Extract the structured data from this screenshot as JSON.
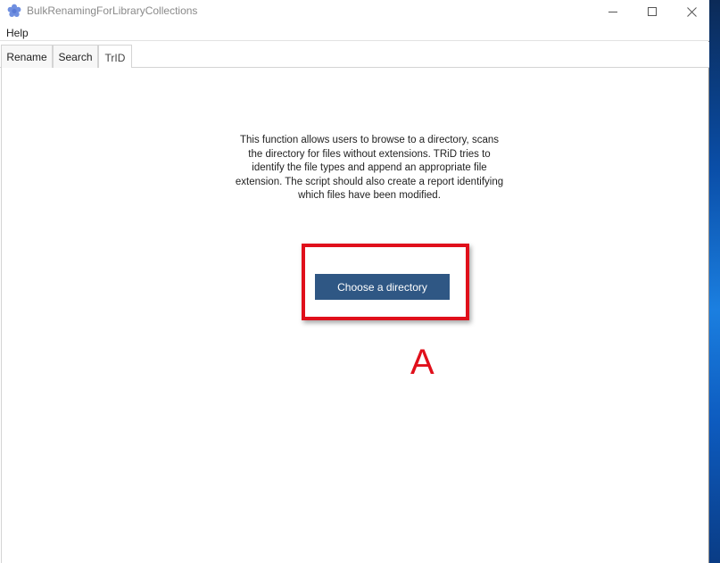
{
  "window": {
    "title": "BulkRenamingForLibraryCollections",
    "buttons": {
      "minimize": "minimize-icon",
      "maximize": "maximize-icon",
      "close": "close-icon"
    }
  },
  "menu": {
    "items": [
      {
        "label": "Help"
      }
    ]
  },
  "tabs": [
    {
      "label": "Rename",
      "selected": false
    },
    {
      "label": "Search",
      "selected": false
    },
    {
      "label": "TrID",
      "selected": true
    }
  ],
  "trid_panel": {
    "description": "This function allows users to browse to a directory, scans the directory for files without extensions. TRiD tries to identify the file types and append an appropriate file extension. The script should also create a report identifying which files have been modified.",
    "choose_button": "Choose a directory"
  },
  "annotation": {
    "label": "A",
    "color": "#e0101b"
  },
  "colors": {
    "button_bg": "#2f5784",
    "highlight": "#e0101b"
  }
}
